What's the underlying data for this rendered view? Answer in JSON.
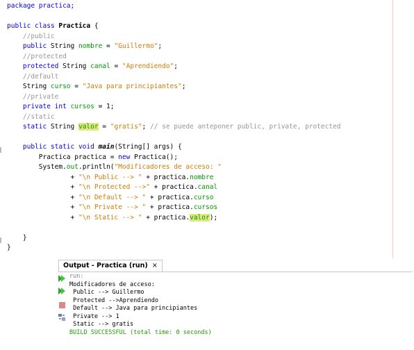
{
  "editor": {
    "lines": [
      {
        "parts": [
          {
            "t": "package practica;",
            "c": "kw"
          }
        ]
      },
      {
        "parts": []
      },
      {
        "parts": [
          {
            "t": "public class ",
            "c": "kw"
          },
          {
            "t": "Practica",
            "c": "b"
          },
          {
            "t": " {",
            "c": ""
          }
        ]
      },
      {
        "parts": [
          {
            "t": "    //public",
            "c": "cmt"
          }
        ]
      },
      {
        "parts": [
          {
            "t": "    public ",
            "c": "kw"
          },
          {
            "t": "String ",
            "c": ""
          },
          {
            "t": "nombre",
            "c": "fld"
          },
          {
            "t": " = ",
            "c": ""
          },
          {
            "t": "\"Guillermo\"",
            "c": "str"
          },
          {
            "t": ";",
            "c": ""
          }
        ]
      },
      {
        "parts": [
          {
            "t": "    //protected",
            "c": "cmt"
          }
        ]
      },
      {
        "parts": [
          {
            "t": "    protected ",
            "c": "kw"
          },
          {
            "t": "String ",
            "c": ""
          },
          {
            "t": "canal",
            "c": "fld"
          },
          {
            "t": " = ",
            "c": ""
          },
          {
            "t": "\"Aprendiendo\"",
            "c": "str"
          },
          {
            "t": ";",
            "c": ""
          }
        ]
      },
      {
        "parts": [
          {
            "t": "    //default",
            "c": "cmt"
          }
        ]
      },
      {
        "parts": [
          {
            "t": "    String ",
            "c": ""
          },
          {
            "t": "curso",
            "c": "fld"
          },
          {
            "t": " = ",
            "c": ""
          },
          {
            "t": "\"Java para principiantes\"",
            "c": "str"
          },
          {
            "t": ";",
            "c": ""
          }
        ]
      },
      {
        "parts": [
          {
            "t": "    //private",
            "c": "cmt"
          }
        ]
      },
      {
        "parts": [
          {
            "t": "    private int ",
            "c": "kw"
          },
          {
            "t": "cursos",
            "c": "fld"
          },
          {
            "t": " = ",
            "c": ""
          },
          {
            "t": "1",
            "c": ""
          },
          {
            "t": ";",
            "c": ""
          }
        ]
      },
      {
        "parts": [
          {
            "t": "    //static",
            "c": "cmt"
          }
        ]
      },
      {
        "parts": [
          {
            "t": "    static ",
            "c": "kw"
          },
          {
            "t": "String ",
            "c": ""
          },
          {
            "t": "valor",
            "c": "fld hl"
          },
          {
            "t": " = ",
            "c": ""
          },
          {
            "t": "\"gratis\"",
            "c": "str"
          },
          {
            "t": "; ",
            "c": ""
          },
          {
            "t": "// se puede anteponer public, private, protected",
            "c": "cmt"
          }
        ]
      },
      {
        "parts": []
      },
      {
        "parts": [
          {
            "t": "    public static void ",
            "c": "kw"
          },
          {
            "t": "main",
            "c": "bi"
          },
          {
            "t": "(String[] args) {",
            "c": ""
          }
        ]
      },
      {
        "parts": [
          {
            "t": "        Practica practica = ",
            "c": ""
          },
          {
            "t": "new ",
            "c": "kw"
          },
          {
            "t": "Practica();",
            "c": ""
          }
        ]
      },
      {
        "parts": [
          {
            "t": "        System.",
            "c": ""
          },
          {
            "t": "out",
            "c": "fld"
          },
          {
            "t": ".println(",
            "c": ""
          },
          {
            "t": "\"Modificadores de acceso: \"",
            "c": "str"
          }
        ]
      },
      {
        "parts": [
          {
            "t": "                + ",
            "c": ""
          },
          {
            "t": "\"\\n Public --> \"",
            "c": "str"
          },
          {
            "t": " + practica.",
            "c": ""
          },
          {
            "t": "nombre",
            "c": "fld"
          }
        ]
      },
      {
        "parts": [
          {
            "t": "                + ",
            "c": ""
          },
          {
            "t": "\"\\n Protected -->\"",
            "c": "str"
          },
          {
            "t": " + practica.",
            "c": ""
          },
          {
            "t": "canal",
            "c": "fld"
          }
        ]
      },
      {
        "parts": [
          {
            "t": "                + ",
            "c": ""
          },
          {
            "t": "\"\\n Default --> \"",
            "c": "str"
          },
          {
            "t": " + practica.",
            "c": ""
          },
          {
            "t": "curso",
            "c": "fld"
          }
        ]
      },
      {
        "parts": [
          {
            "t": "                + ",
            "c": ""
          },
          {
            "t": "\"\\n Private --> \"",
            "c": "str"
          },
          {
            "t": " + practica.",
            "c": ""
          },
          {
            "t": "cursos",
            "c": "fld"
          }
        ]
      },
      {
        "parts": [
          {
            "t": "                + ",
            "c": ""
          },
          {
            "t": "\"\\n Static --> \"",
            "c": "str"
          },
          {
            "t": " + practica.",
            "c": ""
          },
          {
            "t": "valor",
            "c": "fld hl"
          },
          {
            "t": ");",
            "c": ""
          }
        ]
      },
      {
        "parts": []
      },
      {
        "parts": [
          {
            "t": "    }",
            "c": ""
          }
        ]
      },
      {
        "parts": [
          {
            "t": "}",
            "c": ""
          }
        ]
      }
    ]
  },
  "output": {
    "tab_title": "Output - Practica (run)",
    "close_glyph": "×",
    "lines": [
      {
        "t": "run:",
        "c": "gray"
      },
      {
        "t": "Modificadores de acceso:",
        "c": ""
      },
      {
        "t": " Public --> Guillermo",
        "c": ""
      },
      {
        "t": " Protected -->Aprendiendo",
        "c": ""
      },
      {
        "t": " Default --> Java para principiantes",
        "c": ""
      },
      {
        "t": " Private --> 1",
        "c": ""
      },
      {
        "t": " Static --> gratis",
        "c": ""
      },
      {
        "t": "BUILD SUCCESSFUL (total time: 0 seconds)",
        "c": "green"
      }
    ],
    "toolbar": [
      {
        "name": "rerun-icon",
        "color": "#2fa52f"
      },
      {
        "name": "rerun-with-params-icon",
        "color": "#2fa52f"
      },
      {
        "name": "stop-icon",
        "color": "#d88a8a"
      },
      {
        "name": "settings-icon",
        "color": "#6a7fa8"
      }
    ]
  }
}
